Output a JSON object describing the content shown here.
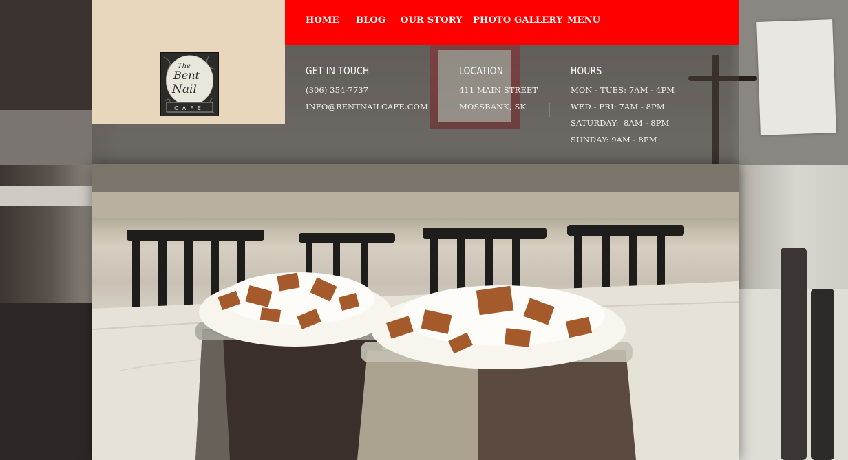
{
  "nav": {
    "items": [
      "HOME",
      "BLOG",
      "OUR STORY",
      "PHOTO GALLERY",
      "MENU"
    ]
  },
  "logo": {
    "lines": [
      "The",
      "Bent",
      "Nail",
      "CAFE"
    ]
  },
  "contact": {
    "title": "GET IN TOUCH",
    "phone": "(306) 354-7737",
    "email": "INFO@BENTNAILCAFE.COM"
  },
  "location": {
    "title": "LOCATION",
    "street": "411 MAIN STREET",
    "city": "MOSSBANK, SK"
  },
  "hours": {
    "title": "HOURS",
    "lines": [
      "MON - TUES: 7AM - 4PM",
      "WED - FRI: 7AM - 8PM",
      "SATURDAY:  8AM - 8PM",
      "SUNDAY: 9AM - 8PM"
    ]
  },
  "colors": {
    "nav_bg": "#ff0000",
    "logo_panel_bg": "#e8d6bd"
  }
}
